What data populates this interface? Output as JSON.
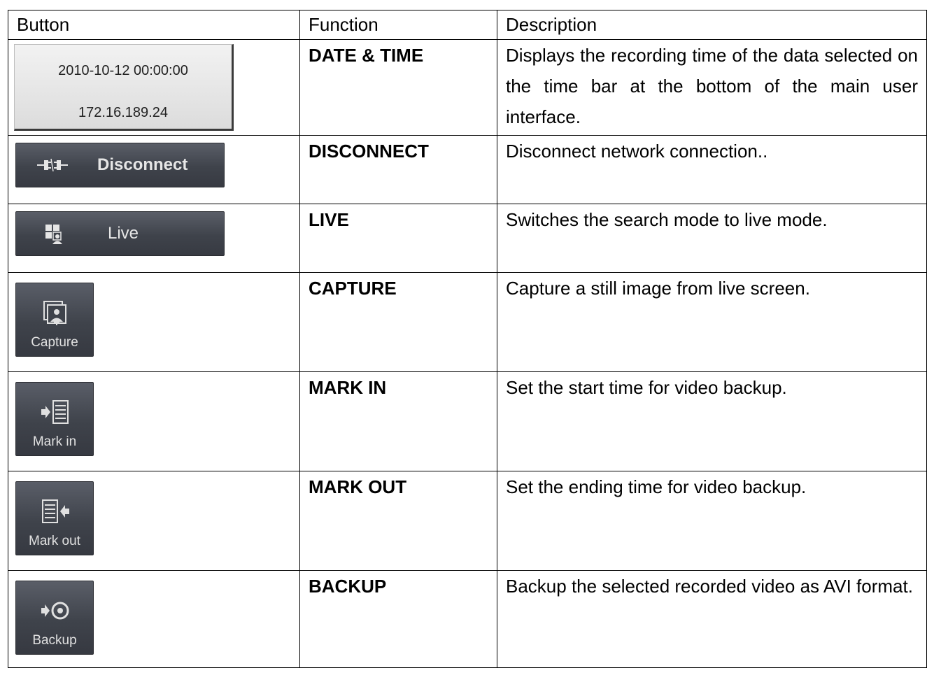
{
  "headers": {
    "button": "Button",
    "function": "Function",
    "description": "Description"
  },
  "rows": [
    {
      "function": "DATE & TIME",
      "description": "Displays the recording time of the data selected on the time bar at the bottom of the main user interface.",
      "button": {
        "line1": "2010-10-12 00:00:00",
        "line2": "172.16.189.24"
      }
    },
    {
      "function": "DISCONNECT",
      "description": "Disconnect network connection..",
      "button": {
        "label": "Disconnect",
        "icon": "disconnect-plug-icon"
      }
    },
    {
      "function": "LIVE",
      "description": "Switches the search mode to live mode.",
      "button": {
        "label": "Live",
        "icon": "live-view-icon"
      }
    },
    {
      "function": "CAPTURE",
      "description": "Capture a still image from live screen.",
      "button": {
        "label": "Capture",
        "icon": "capture-icon"
      }
    },
    {
      "function": "MARK IN",
      "description": "Set the start time for video backup.",
      "button": {
        "label": "Mark in",
        "icon": "mark-in-icon"
      }
    },
    {
      "function": "MARK OUT",
      "description": "Set the ending time for video backup.",
      "button": {
        "label": "Mark out",
        "icon": "mark-out-icon"
      }
    },
    {
      "function": "BACKUP",
      "description": "Backup the selected recorded video as AVI format.",
      "button": {
        "label": "Backup",
        "icon": "backup-disc-icon"
      }
    }
  ]
}
